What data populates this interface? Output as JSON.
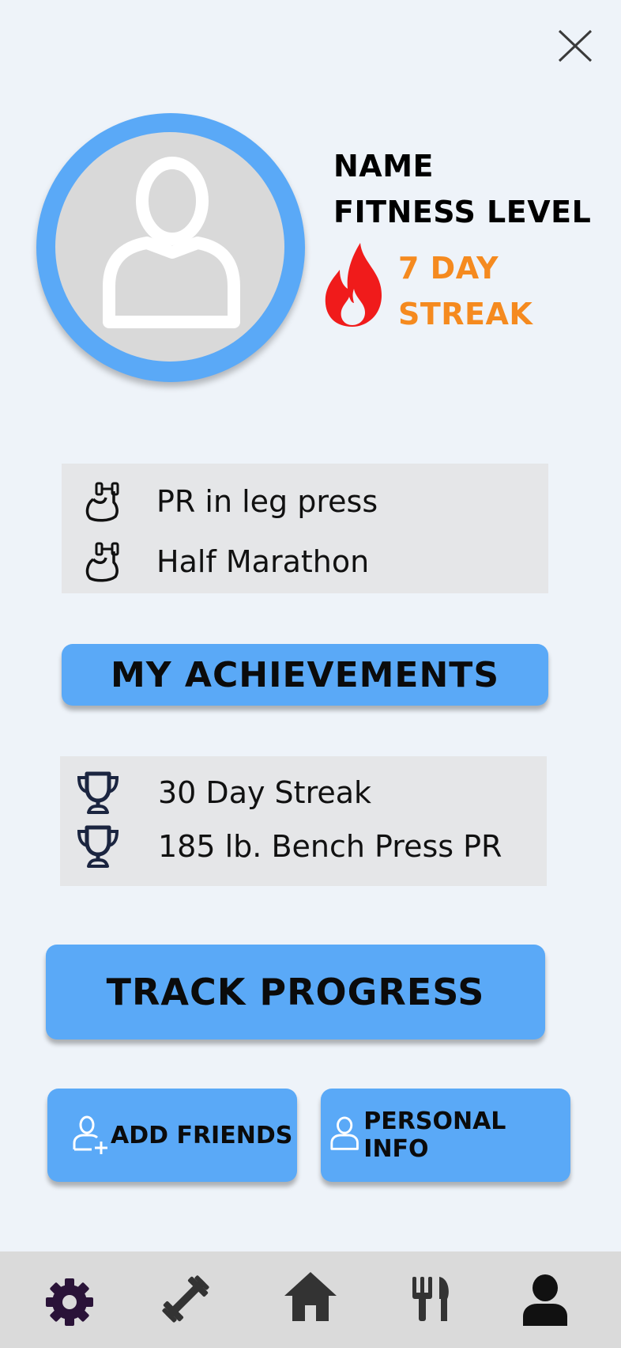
{
  "header": {
    "close_icon": "close-icon"
  },
  "profile": {
    "avatar_icon": "user-avatar-icon",
    "name_label": "NAME",
    "fitness_level_label": "FITNESS LEVEL",
    "streak_line1": "7 DAY",
    "streak_line2": "STREAK",
    "streak_icon": "flame-icon",
    "streak_color": "#f58a1f",
    "flame_color": "#f01b1b"
  },
  "recent": {
    "items": [
      {
        "icon": "flexed-arm-dumbbell-icon",
        "label": "PR in leg press"
      },
      {
        "icon": "flexed-arm-dumbbell-icon",
        "label": "Half Marathon"
      }
    ]
  },
  "achievements_button": {
    "label": "MY ACHIEVEMENTS"
  },
  "achievements": {
    "items": [
      {
        "icon": "trophy-icon",
        "label": "30 Day Streak"
      },
      {
        "icon": "trophy-icon",
        "label": "185 lb. Bench Press PR"
      }
    ]
  },
  "track_button": {
    "label": "TRACK PROGRESS"
  },
  "actions": {
    "add_friends": {
      "label": "ADD FRIENDS",
      "icon": "add-user-icon"
    },
    "personal_info": {
      "label": "PERSONAL INFO",
      "icon": "user-icon"
    }
  },
  "bottom_nav": {
    "items": [
      {
        "icon": "gear-icon",
        "active": true
      },
      {
        "icon": "dumbbell-icon"
      },
      {
        "icon": "home-icon"
      },
      {
        "icon": "fork-knife-icon"
      },
      {
        "icon": "profile-icon"
      }
    ]
  },
  "colors": {
    "accent": "#5aa9f7",
    "background": "#eef3f9",
    "card": "#e5e6e8",
    "nav": "#dadada",
    "active_nav": "#2a1338"
  }
}
